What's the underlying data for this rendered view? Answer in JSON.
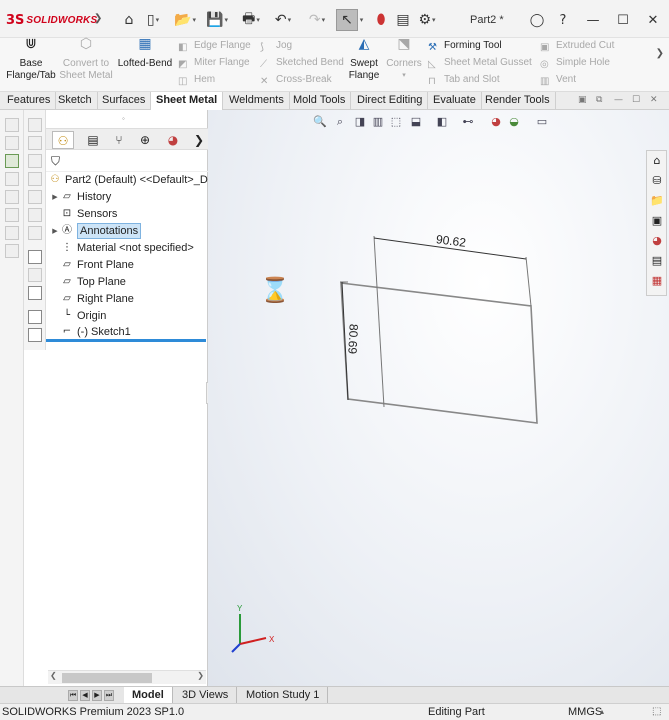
{
  "app": {
    "logo_mark": "3S",
    "logo_text": "SOLIDWORKS",
    "document_title": "Part2 *"
  },
  "quick_access": [
    "home-icon",
    "new-document-icon",
    "open-folder-icon",
    "save-icon",
    "print-icon",
    "undo-icon",
    "redo-icon",
    "select-arrow-icon",
    "traffic-light-icon",
    "file-properties-icon",
    "options-gear-icon"
  ],
  "ribbon": {
    "big": {
      "base_flange": "Base\nFlange/Tab",
      "convert": "Convert to\nSheet Metal",
      "lofted_bend": "Lofted-Bend",
      "swept_flange": "Swept\nFlange",
      "corners": "Corners"
    },
    "small": {
      "edge_flange": "Edge Flange",
      "miter_flange": "Miter Flange",
      "hem": "Hem",
      "jog": "Jog",
      "sketched_bend": "Sketched Bend",
      "cross_break": "Cross-Break",
      "forming_tool": "Forming Tool",
      "gusset": "Sheet Metal Gusset",
      "tab_slot": "Tab and Slot",
      "extruded_cut": "Extruded Cut",
      "simple_hole": "Simple Hole",
      "vent": "Vent"
    }
  },
  "tabs": [
    "Features",
    "Sketch",
    "Surfaces",
    "Sheet Metal",
    "Weldments",
    "Mold Tools",
    "Direct Editing",
    "Evaluate",
    "Render Tools"
  ],
  "active_tab": "Sheet Metal",
  "tree": {
    "root": "Part2 (Default) <<Default>_Di",
    "items": {
      "history": "History",
      "sensors": "Sensors",
      "annotations": "Annotations",
      "material": "Material <not specified>",
      "front": "Front Plane",
      "top": "Top Plane",
      "right": "Right Plane",
      "origin": "Origin",
      "sketch": "(-) Sketch1"
    }
  },
  "sketch": {
    "dim_horizontal": "90.62",
    "dim_vertical": "80.69"
  },
  "triad": {
    "x": "X",
    "y": "Y"
  },
  "bottom_tabs": [
    "Model",
    "3D Views",
    "Motion Study 1"
  ],
  "status": {
    "left": "SOLIDWORKS Premium 2023 SP1.0",
    "middle": "Editing Part",
    "units": "MMGS"
  }
}
